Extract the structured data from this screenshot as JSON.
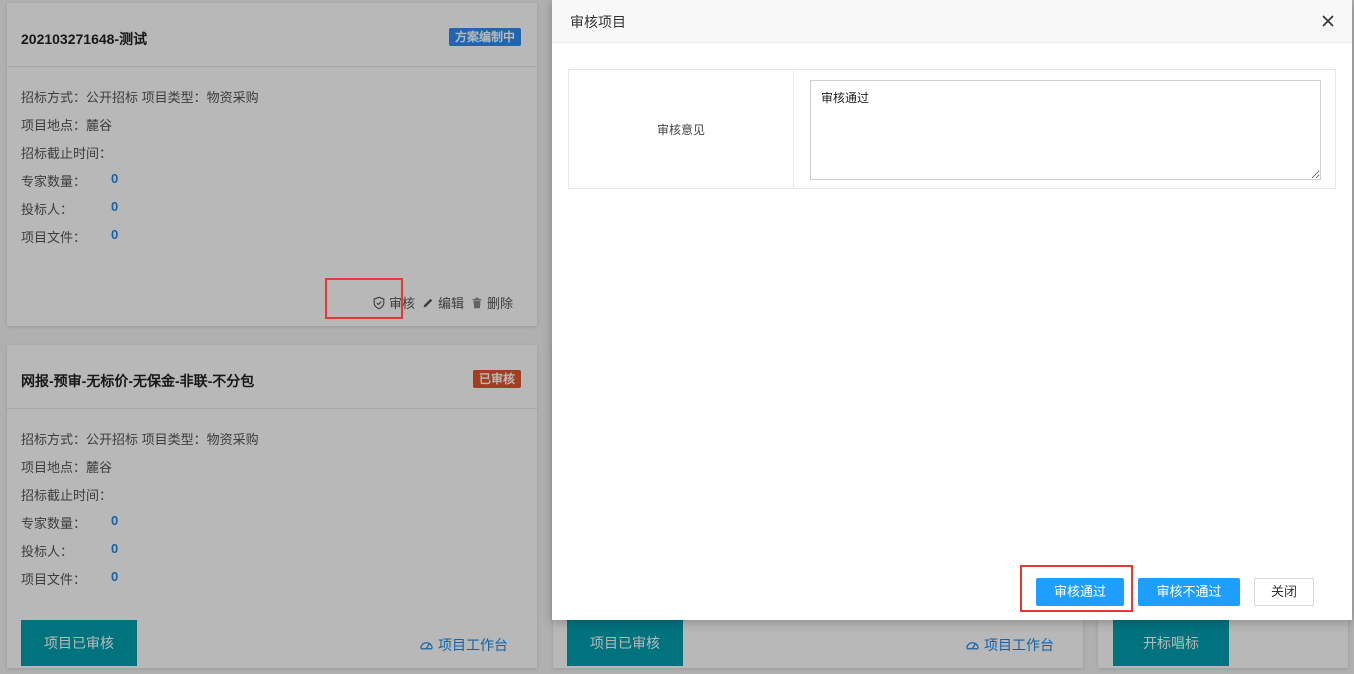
{
  "cards": [
    {
      "title": "202103271648-测试",
      "status": "方案编制中",
      "line1": "招标方式：公开招标   项目类型：物资采购",
      "location": "项目地点：麓谷",
      "deadline": "招标截止时间：",
      "experts_label": "专家数量：",
      "experts_value": "0",
      "bidders_label": "投标人：",
      "bidders_value": "0",
      "files_label": "项目文件：",
      "files_value": "0",
      "actions": {
        "review": "审核",
        "edit": "编辑",
        "delete": "删除"
      }
    },
    {
      "title": "网报-预审-无标价-无保金-非联-不分包",
      "status": "已审核",
      "line1": "招标方式：公开招标   项目类型：物资采购",
      "location": "项目地点：麓谷",
      "deadline": "招标截止时间：",
      "experts_label": "专家数量：",
      "experts_value": "0",
      "bidders_label": "投标人：",
      "bidders_value": "0",
      "files_label": "项目文件：",
      "files_value": "0",
      "primary_button": "项目已审核",
      "workbench": "项目工作台"
    }
  ],
  "card_middle": {
    "primary_button": "项目已审核",
    "workbench": "项目工作台"
  },
  "card_right": {
    "primary_button": "开标唱标"
  },
  "dialog": {
    "title": "审核项目",
    "field_label": "审核意见",
    "field_value": "审核通过",
    "btn_approve": "审核通过",
    "btn_reject": "审核不通过",
    "btn_close": "关闭"
  },
  "colors": {
    "teal": "#00a0b0",
    "primary": "#1e9fff",
    "badge_blue": "#2d8cf0",
    "badge_red": "#e4572e",
    "highlight": "#e53935"
  }
}
